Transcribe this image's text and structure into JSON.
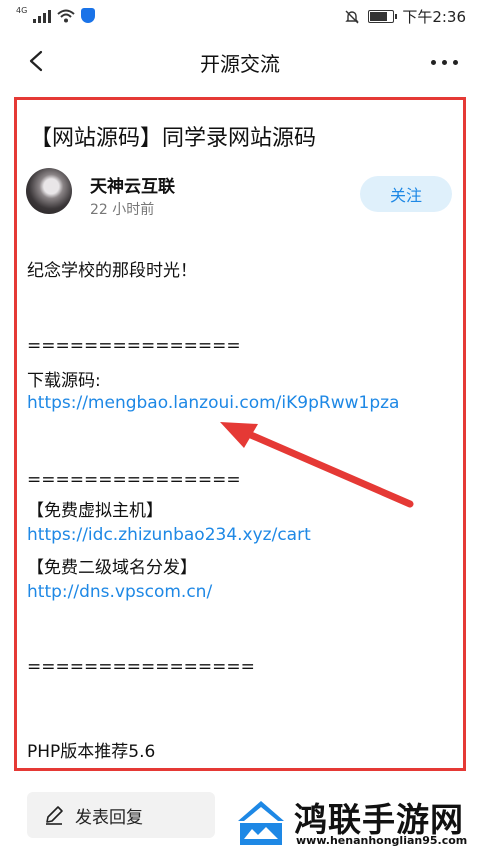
{
  "status_bar": {
    "network_label": "4G",
    "time": "下午2:36"
  },
  "navbar": {
    "title": "开源交流"
  },
  "post": {
    "title": "【网站源码】同学录网站源码",
    "author": "天神云互联",
    "time_ago": "22 小时前",
    "follow_label": "关注",
    "lines": {
      "intro": "纪念学校的那段时光！",
      "divider1": "===============",
      "download_label": "下载源码:",
      "download_link": "https://mengbao.lanzoui.com/iK9pRww1pza",
      "divider2": "===============",
      "vhost_label": "【免费虚拟主机】",
      "vhost_link": "https://idc.zhizunbao234.xyz/cart",
      "domain_label": "【免费二级域名分发】",
      "domain_link": "http://dns.vpscom.cn/",
      "divider3": "================",
      "php_note": "PHP版本推荐5.6"
    }
  },
  "bottom_bar": {
    "reply_label": "发表回复"
  },
  "watermark": {
    "name": "鸿联手游网",
    "url": "www.henanhonglian95.com"
  },
  "colors": {
    "accent": "#1e88e5",
    "highlight": "#e53935",
    "follow_bg": "#dff0fb"
  }
}
